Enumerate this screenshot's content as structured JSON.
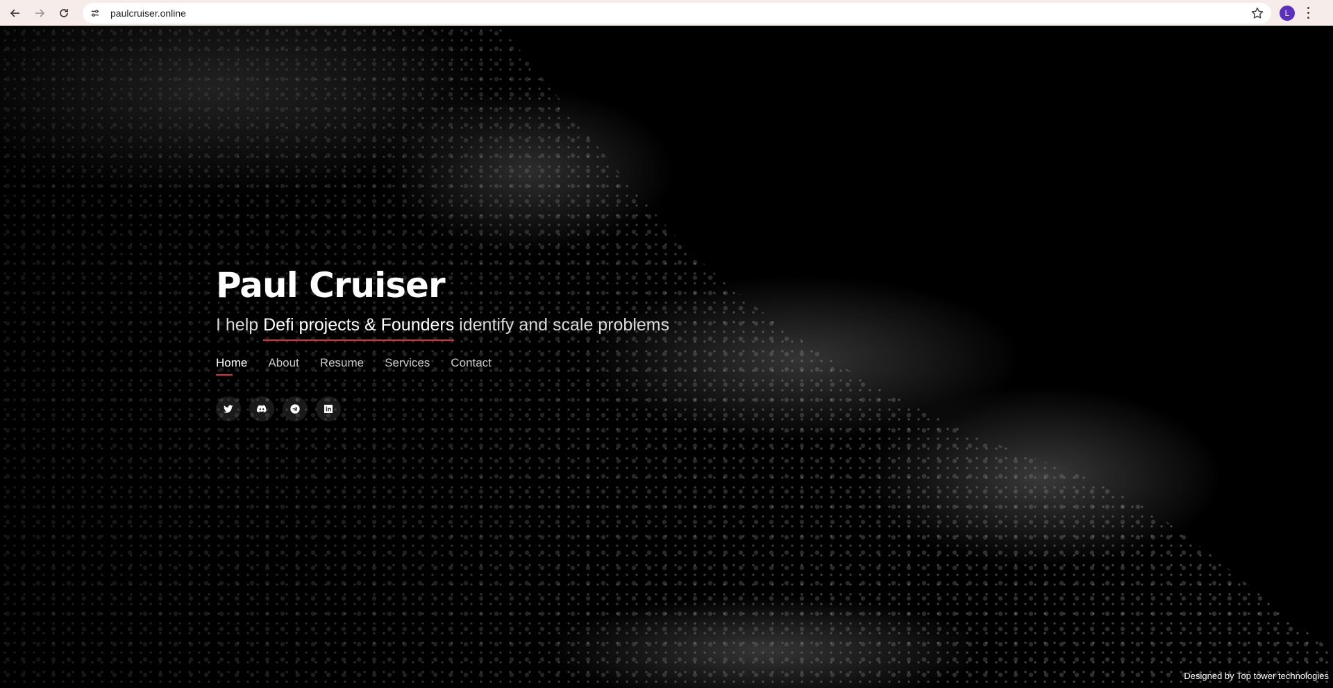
{
  "browser": {
    "url": "paulcruiser.online",
    "profile_initial": "L"
  },
  "hero": {
    "name": "Paul Cruiser",
    "tagline_pre": "I help ",
    "tagline_highlight": "Defi projects & Founders",
    "tagline_post": " identify and scale problems"
  },
  "nav": {
    "items": [
      {
        "label": "Home",
        "active": true
      },
      {
        "label": "About"
      },
      {
        "label": "Resume"
      },
      {
        "label": "Services"
      },
      {
        "label": "Contact"
      }
    ]
  },
  "socials": [
    "twitter-icon",
    "discord-icon",
    "telegram-icon",
    "linkedin-icon"
  ],
  "footer": {
    "credit": "Designed by Top tower technologies"
  },
  "colors": {
    "accent": "#e02d3c",
    "background": "#000000",
    "chrome": "#f6ecea"
  }
}
